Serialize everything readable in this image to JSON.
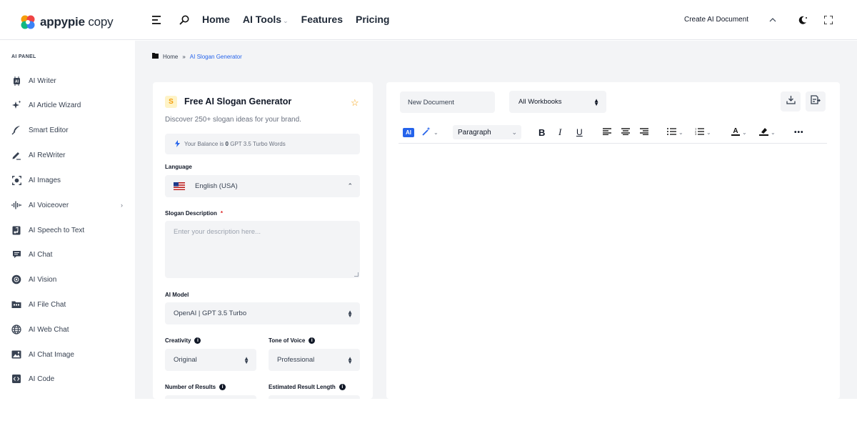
{
  "app": {
    "logo_main": "appypie",
    "logo_sub": "copy"
  },
  "topnav": {
    "items": [
      {
        "label": "Home"
      },
      {
        "label": "AI Tools",
        "has_caret": true
      },
      {
        "label": "Features"
      },
      {
        "label": "Pricing"
      }
    ],
    "create_doc_label": "Create AI Document"
  },
  "sidebar": {
    "panel_label": "AI PANEL",
    "items": [
      {
        "label": "AI Writer",
        "icon": "ai-chip-icon"
      },
      {
        "label": "AI Article Wizard",
        "icon": "sparkle-icon"
      },
      {
        "label": "Smart Editor",
        "icon": "feather-icon"
      },
      {
        "label": "AI ReWriter",
        "icon": "pen-icon"
      },
      {
        "label": "AI Images",
        "icon": "image-scan-icon"
      },
      {
        "label": "AI Voiceover",
        "icon": "waveform-icon",
        "has_chevron": true
      },
      {
        "label": "AI Speech to Text",
        "icon": "audio-file-icon"
      },
      {
        "label": "AI Chat",
        "icon": "chat-icon"
      },
      {
        "label": "AI Vision",
        "icon": "vision-icon"
      },
      {
        "label": "AI File Chat",
        "icon": "folder-icon"
      },
      {
        "label": "AI Web Chat",
        "icon": "globe-icon"
      },
      {
        "label": "AI Chat Image",
        "icon": "photo-icon"
      },
      {
        "label": "AI Code",
        "icon": "code-icon"
      }
    ]
  },
  "breadcrumb": {
    "home": "Home",
    "sep": "»",
    "current": "AI Slogan Generator"
  },
  "form": {
    "badge": "S",
    "title": "Free AI Slogan Generator",
    "subtitle": "Discover 250+ slogan ideas for your brand.",
    "balance_prefix": "Your Balance is",
    "balance_value": "0",
    "balance_suffix": "GPT 3.5 Turbo Words",
    "language_label": "Language",
    "language_value": "English (USA)",
    "description_label": "Slogan Description",
    "description_required": "*",
    "description_placeholder": "Enter your description here...",
    "model_label": "AI Model",
    "model_value": "OpenAI | GPT 3.5 Turbo",
    "creativity_label": "Creativity",
    "creativity_value": "Original",
    "tone_label": "Tone of Voice",
    "tone_value": "Professional",
    "results_label": "Number of Results",
    "length_label": "Estimated Result Length"
  },
  "editor": {
    "doc_name": "New Document",
    "workbook": "All Workbooks",
    "ai_chip": "AI",
    "paragraph": "Paragraph",
    "bold": "B",
    "italic": "I",
    "underline": "U",
    "more": "•••"
  },
  "colors": {
    "accent": "#2563eb",
    "star": "#f59e0b",
    "required": "#dc2626",
    "main_bg": "#f3f4f6"
  }
}
